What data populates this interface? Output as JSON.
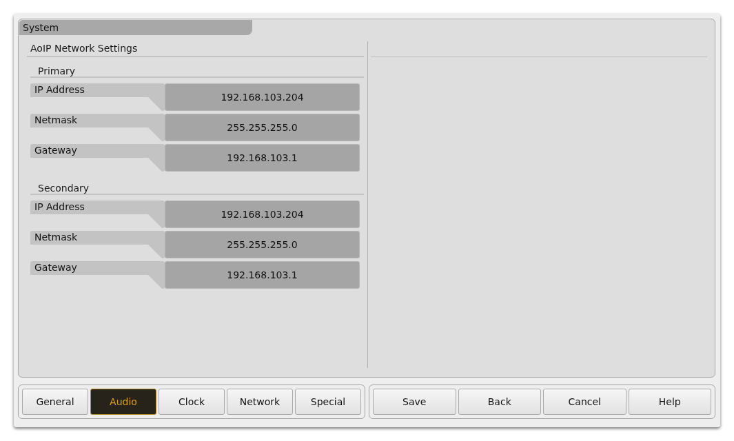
{
  "window": {
    "title": "System"
  },
  "panel": {
    "title": "AoIP Network Settings",
    "sections": [
      {
        "title": "Primary",
        "fields": [
          {
            "label": "IP Address",
            "value": "192.168.103.204"
          },
          {
            "label": "Netmask",
            "value": "255.255.255.0"
          },
          {
            "label": "Gateway",
            "value": "192.168.103.1"
          }
        ]
      },
      {
        "title": "Secondary",
        "fields": [
          {
            "label": "IP Address",
            "value": "192.168.103.204"
          },
          {
            "label": "Netmask",
            "value": "255.255.255.0"
          },
          {
            "label": "Gateway",
            "value": "192.168.103.1"
          }
        ]
      }
    ]
  },
  "tabs": [
    {
      "label": "General",
      "selected": false
    },
    {
      "label": "Audio",
      "selected": true
    },
    {
      "label": "Clock",
      "selected": false
    },
    {
      "label": "Network",
      "selected": false
    },
    {
      "label": "Special",
      "selected": false
    }
  ],
  "buttons": [
    "Save",
    "Back",
    "Cancel",
    "Help"
  ]
}
